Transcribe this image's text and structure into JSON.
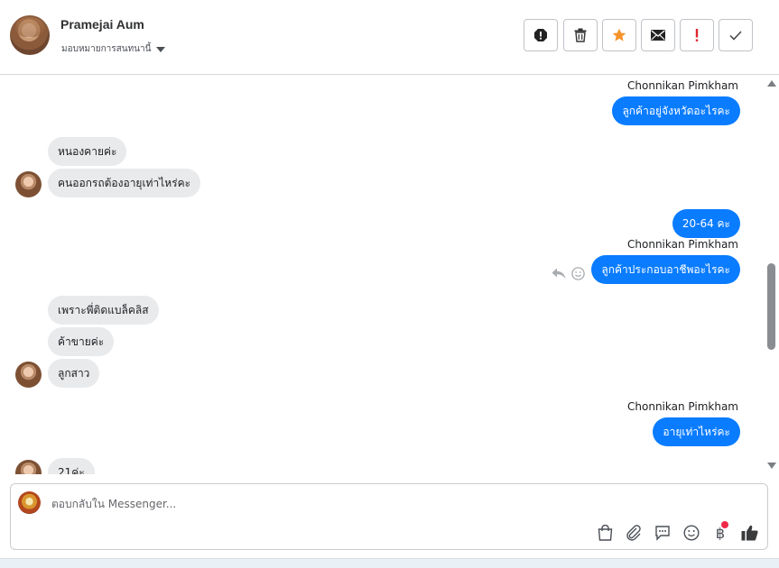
{
  "header": {
    "contact_name": "Pramejai Aum",
    "assign_label": "มอบหมายการสนทนานี้",
    "actions": [
      {
        "name": "spam-icon"
      },
      {
        "name": "trash-icon"
      },
      {
        "name": "star-icon",
        "color": "#f5932a"
      },
      {
        "name": "mail-icon"
      },
      {
        "name": "follow-up-icon",
        "color": "#e0242f"
      },
      {
        "name": "check-icon"
      }
    ]
  },
  "messages": [
    {
      "dir": "out",
      "sender": "Chonnikan Pimkham",
      "text": "ลูกค้าอยู่จังหวัดอะไรคะ"
    },
    {
      "dir": "in",
      "text": "หนองคายค่ะ"
    },
    {
      "dir": "in",
      "text": "คนออกรถต้องอายุเท่าไหร่คะ"
    },
    {
      "dir": "out",
      "text": "20-64 คะ"
    },
    {
      "dir": "out",
      "sender": "Chonnikan Pimkham",
      "text": "ลูกค้าประกอบอาชีพอะไรคะ"
    },
    {
      "dir": "in",
      "text": "เพราะพี่ติดแบล็คลิส"
    },
    {
      "dir": "in",
      "text": "ค้าขายค่ะ"
    },
    {
      "dir": "in",
      "text": "ลูกสาว"
    },
    {
      "dir": "out",
      "sender": "Chonnikan Pimkham",
      "text": "อายุเท่าไหร่คะ"
    },
    {
      "dir": "in",
      "text": "21ค่ะ"
    }
  ],
  "composer": {
    "placeholder": "ตอบกลับใน Messenger..."
  },
  "composer_tools": [
    "shopping-bag-icon",
    "paperclip-icon",
    "saved-reply-icon",
    "emoji-icon",
    "payment-baht-icon",
    "like-icon"
  ],
  "colors": {
    "accent": "#0a7cff",
    "incoming_bubble": "#e9eaec"
  }
}
